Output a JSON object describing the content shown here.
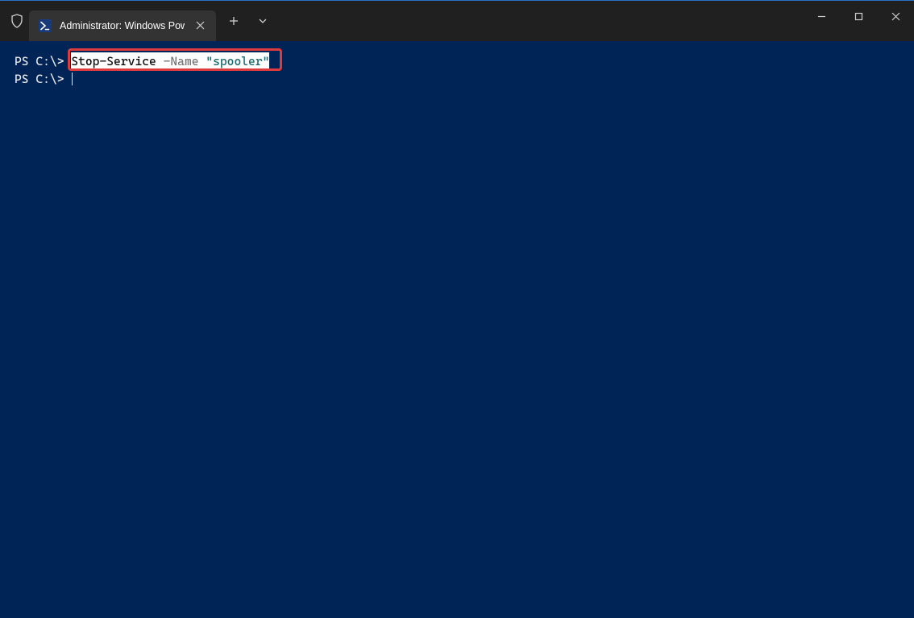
{
  "titlebar": {
    "tab_title": "Administrator: Windows Powe",
    "ps_icon_text": ">_"
  },
  "terminal": {
    "lines": [
      {
        "prompt": "PS C:\\> ",
        "command": {
          "cmdlet": "Stop-Service",
          "param": " -Name ",
          "string": "\"spooler\""
        },
        "selected": true
      },
      {
        "prompt": "PS C:\\> ",
        "command": null,
        "cursor": true
      }
    ]
  },
  "colors": {
    "background": "#012456",
    "titlebar": "#202020",
    "tab_active": "#333333",
    "highlight_border": "#de3b3e",
    "selection_bg": "#fefefe"
  }
}
